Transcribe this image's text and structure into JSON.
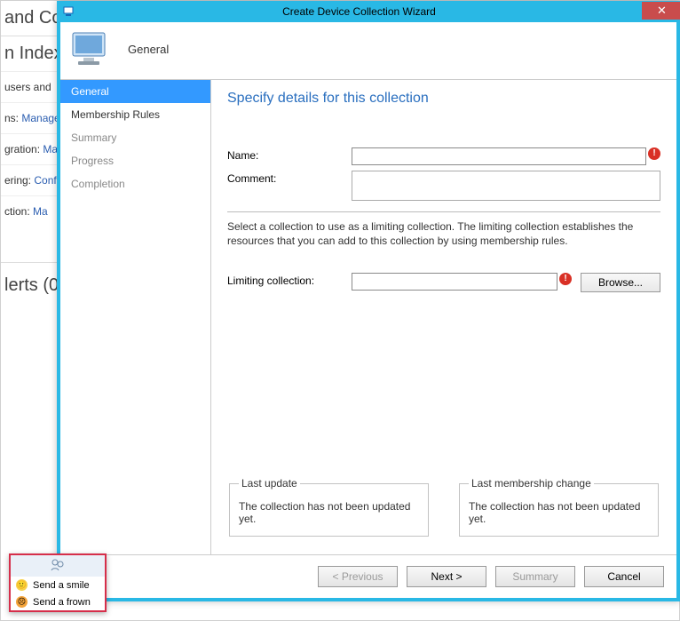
{
  "background": {
    "title": "and Co",
    "section": "n Index",
    "rows": [
      {
        "left": "users and",
        "blue": "",
        "rest": ""
      },
      {
        "left": "ns: ",
        "blue": "Manage",
        "rest": ""
      },
      {
        "left": "gration: ",
        "blue": "Ma",
        "rest": ""
      },
      {
        "left": "ering: ",
        "blue": "Conf",
        "rest": ""
      },
      {
        "left": "ction: ",
        "blue": "Ma",
        "rest": ""
      }
    ],
    "alerts": "lerts (0)"
  },
  "dialog": {
    "title": "Create Device Collection Wizard",
    "header_label": "General",
    "sidebar": [
      {
        "label": "General",
        "selected": true,
        "dim": false
      },
      {
        "label": "Membership Rules",
        "selected": false,
        "dim": false
      },
      {
        "label": "Summary",
        "selected": false,
        "dim": true
      },
      {
        "label": "Progress",
        "selected": false,
        "dim": true
      },
      {
        "label": "Completion",
        "selected": false,
        "dim": true
      }
    ],
    "page_title": "Specify details for this collection",
    "labels": {
      "name": "Name:",
      "comment": "Comment:",
      "limiting": "Limiting collection:"
    },
    "fields": {
      "name": "",
      "comment": "",
      "limiting": ""
    },
    "instruction": "Select a collection to use as a limiting collection. The limiting collection establishes the resources that you can add to this collection by using membership rules.",
    "browse_label": "Browse...",
    "groups": {
      "last_update_legend": "Last update",
      "last_update_value": "The collection has not been updated yet.",
      "last_membership_legend": "Last membership change",
      "last_membership_value": "The collection has not been updated yet."
    },
    "buttons": {
      "previous": "< Previous",
      "next": "Next >",
      "summary": "Summary",
      "cancel": "Cancel"
    }
  },
  "feedback": {
    "smile": "Send a smile",
    "frown": "Send a frown"
  }
}
